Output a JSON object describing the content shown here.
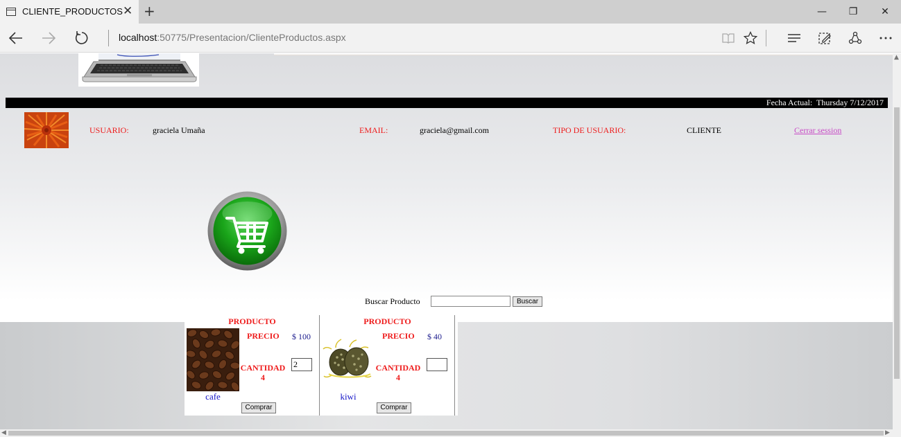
{
  "browser": {
    "tab_title": "CLIENTE_PRODUCTOS",
    "tab_close": "✕",
    "new_tab": "+",
    "url_host": "localhost",
    "url_rest": ":50775/Presentacion/ClienteProductos.aspx",
    "window_controls": {
      "minimize": "—",
      "restore": "❐",
      "close": "✕"
    },
    "icons": [
      "back-icon",
      "forward-icon",
      "refresh-icon",
      "reading-view-icon",
      "favorite-star-icon",
      "hub-icon",
      "web-note-icon",
      "share-icon",
      "more-icon"
    ]
  },
  "header": {
    "date_label": "Fecha Actual:",
    "date_value": "Thursday 7/12/2017"
  },
  "user": {
    "usuario_label": "USUARIO:",
    "usuario_value": "graciela Umaña",
    "email_label": "EMAIL:",
    "email_value": "graciela@gmail.com",
    "tipo_label": "TIPO DE USUARIO:",
    "tipo_value": "CLIENTE",
    "logout": "Cerrar session"
  },
  "search": {
    "label": "Buscar Producto",
    "value": "",
    "button": "Buscar"
  },
  "products": [
    {
      "title": "PRODUCTO",
      "precio_label": "PRECIO",
      "price": "$ 100",
      "cantidad_label": "CANTIDAD",
      "stock": "4",
      "quantity": "2",
      "name": "cafe",
      "button": "Comprar"
    },
    {
      "title": "PRODUCTO",
      "precio_label": "PRECIO",
      "price": "$ 40",
      "cantidad_label": "CANTIDAD",
      "stock": "4",
      "quantity": "",
      "name": "kiwi",
      "button": "Comprar"
    }
  ],
  "colors": {
    "label_red": "#ee1c1c",
    "price_blue": "#1a1a8c",
    "name_blue": "#1515c8",
    "logout_link": "#c84bc6",
    "date_bar": "#000000",
    "cart_green": "#1aa51a"
  }
}
